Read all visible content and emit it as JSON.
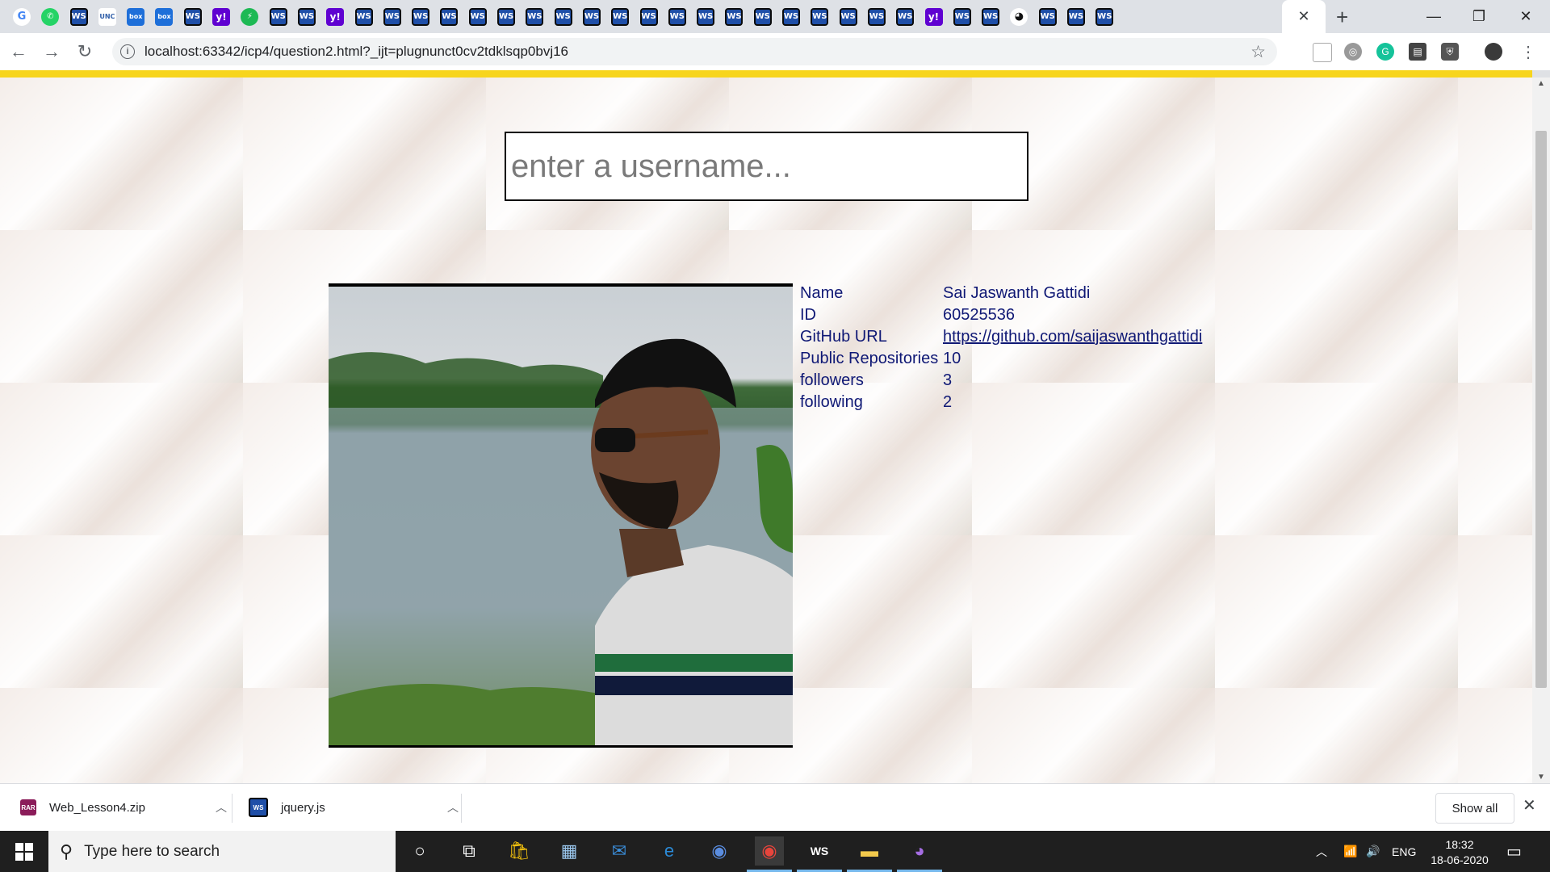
{
  "browser": {
    "favicons": [
      "google",
      "whatsapp",
      "webstorm",
      "unc",
      "box",
      "box",
      "webstorm",
      "yahoo",
      "green",
      "webstorm",
      "webstorm",
      "yahoo",
      "webstorm",
      "webstorm",
      "webstorm",
      "webstorm",
      "webstorm",
      "webstorm",
      "webstorm",
      "webstorm",
      "webstorm",
      "webstorm",
      "webstorm",
      "webstorm",
      "webstorm",
      "webstorm",
      "webstorm",
      "webstorm",
      "webstorm",
      "webstorm",
      "webstorm",
      "webstorm",
      "yahoo",
      "webstorm",
      "webstorm",
      "github",
      "webstorm",
      "webstorm",
      "webstorm"
    ],
    "url": "localhost:63342/icp4/question2.html?_ijt=plugnunct0cv2tdklsqp0bvj16"
  },
  "page": {
    "search_placeholder": "enter a username...",
    "profile": {
      "rows": [
        {
          "key": "Name",
          "value": "Sai Jaswanth Gattidi"
        },
        {
          "key": "ID",
          "value": "60525536"
        },
        {
          "key": "GitHub URL",
          "value": "https://github.com/saijaswanthgattidi",
          "link": true
        },
        {
          "key": "Public Repositories",
          "value": "10"
        },
        {
          "key": "followers",
          "value": "3"
        },
        {
          "key": "following",
          "value": "2"
        }
      ]
    }
  },
  "downloads": {
    "items": [
      {
        "name": "Web_Lesson4.zip",
        "icon": "winrar-icon"
      },
      {
        "name": "jquery.js",
        "icon": "webstorm-icon"
      }
    ],
    "show_all": "Show all"
  },
  "taskbar": {
    "search_placeholder": "Type here to search",
    "language": "ENG",
    "time": "18:32",
    "date": "18-06-2020"
  }
}
